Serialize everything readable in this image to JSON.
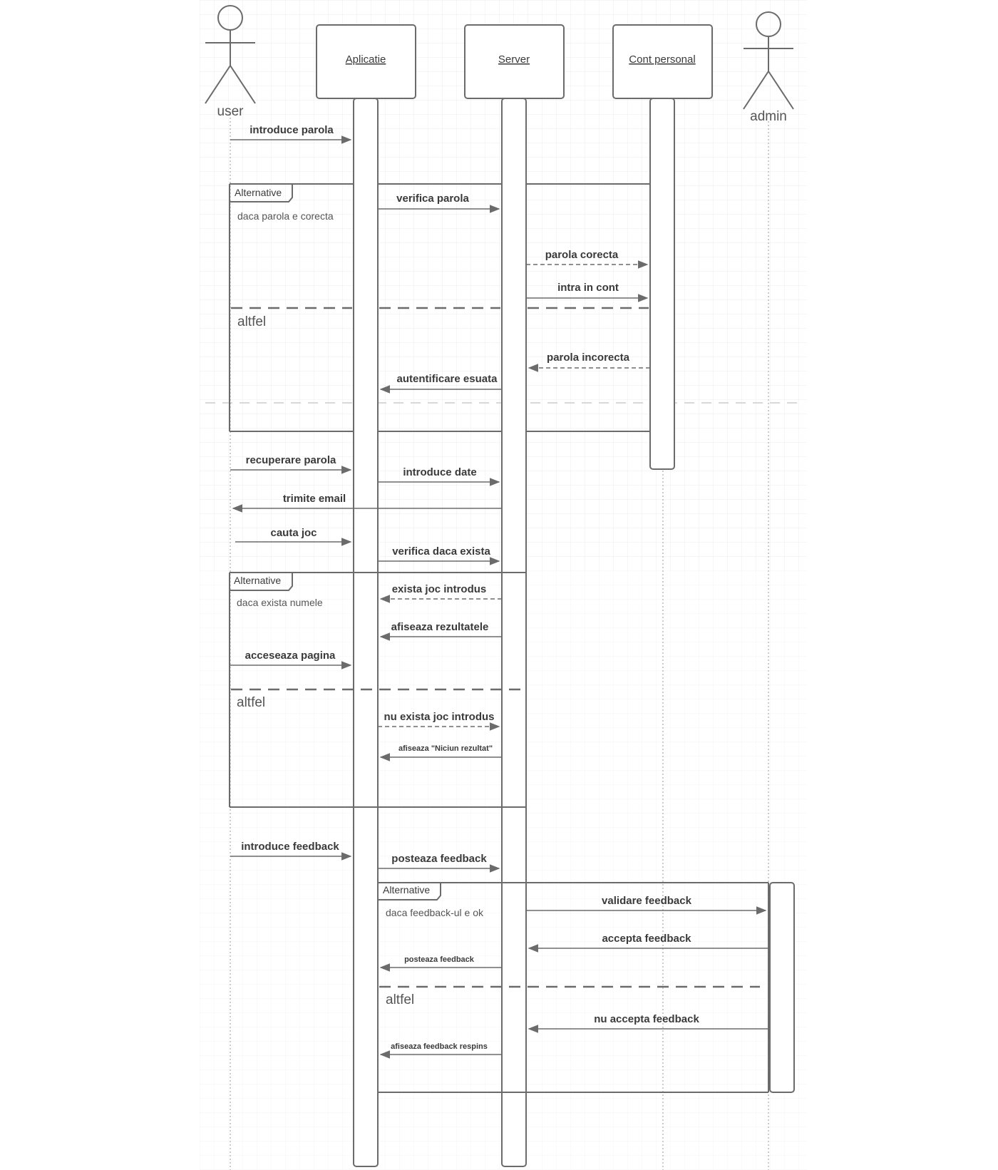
{
  "participants": {
    "user": "user",
    "aplicatie": "Aplicatie",
    "server": "Server",
    "cont": "Cont personal",
    "admin": "admin"
  },
  "messages": {
    "m1": "introduce parola",
    "m2": "verifica parola",
    "m3": "parola corecta",
    "m4": "intra in cont",
    "m5": "parola incorecta",
    "m6": "autentificare esuata",
    "m7": "recuperare parola",
    "m8": "introduce date",
    "m9": "trimite email",
    "m10": "cauta joc",
    "m11": "verifica daca exista",
    "m12": "exista joc introdus",
    "m13": "afiseaza rezultatele",
    "m14": "acceseaza pagina",
    "m15": "nu exista joc introdus",
    "m16": "afiseaza \"Niciun rezultat\"",
    "m17": "introduce feedback",
    "m18": "posteaza feedback",
    "m19": "validare feedback",
    "m20": "accepta feedback",
    "m21": "posteaza feedback",
    "m22": "nu accepta feedback",
    "m23": "afiseaza feedback respins"
  },
  "fragments": {
    "f1": {
      "tag": "Alternative",
      "guard": "daca parola e corecta",
      "else": "altfel"
    },
    "f2": {
      "tag": "Alternative",
      "guard": "daca exista numele",
      "else": "altfel"
    },
    "f3": {
      "tag": "Alternative",
      "guard": "daca feedback-ul e ok",
      "else": "altfel"
    }
  },
  "colors": {
    "line": "#6b6b6b",
    "grid": "#ececec",
    "text": "#3a3a3a"
  }
}
